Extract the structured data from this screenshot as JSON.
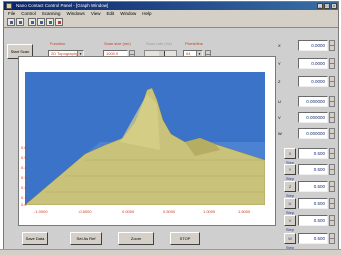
{
  "window": {
    "title": "Nano Contact Control Panel - [Graph Window]",
    "min_symbol": "_",
    "max_symbol": "□",
    "close_symbol": "×"
  },
  "menu": [
    "File",
    "Control",
    "Scanning",
    "Windows",
    "View",
    "Edit",
    "Window",
    "Help"
  ],
  "toolbar": {
    "buttons": [
      "open-icon",
      "save-icon",
      "print-icon",
      "copy-icon",
      "paste-icon",
      "settings-icon"
    ]
  },
  "controls": {
    "start_scan_label": "Start Scan",
    "function_label": "Function",
    "function_value": "2D Topography",
    "dropdown_arrow": "▼",
    "scan_size_label": "Scan size (nm)",
    "scan_size_value": "1000.0",
    "scan_rate_label": "Scan rate (Hz)",
    "pixels_label": "Pixels/line",
    "pixels_value": "64"
  },
  "plot": {
    "surface_color": "#c9c27a",
    "background_color": "#3a73c8",
    "x_ticks": [
      "-1.0000",
      "-0.5000",
      "0.0000",
      "0.5000",
      "1.0000",
      "1.5000"
    ],
    "y_ticks": [
      "0.6",
      "0.5",
      "0.4",
      "0.3",
      "0.2",
      "0.1",
      "0.0"
    ]
  },
  "bottom_buttons": [
    "Save Data",
    "Set As Ref",
    "Zoom",
    "STOP"
  ],
  "right_panel": {
    "coords": [
      {
        "label": "X",
        "value": "0.0000"
      },
      {
        "label": "Y",
        "value": "0.0000"
      },
      {
        "label": "Z",
        "value": "0.0000"
      },
      {
        "label": "U",
        "value": "0.000000"
      },
      {
        "label": "V",
        "value": "0.000000"
      },
      {
        "label": "W",
        "value": "0.000000"
      }
    ],
    "steps": [
      {
        "label": "X Step",
        "value": "0.500"
      },
      {
        "label": "Y Step",
        "value": "0.500"
      },
      {
        "label": "Z Step",
        "value": "0.500"
      },
      {
        "label": "U Step",
        "value": "0.500"
      },
      {
        "label": "V Step",
        "value": "0.500"
      },
      {
        "label": "W Step",
        "value": "0.500"
      }
    ]
  },
  "accent_color": "#c8401e"
}
